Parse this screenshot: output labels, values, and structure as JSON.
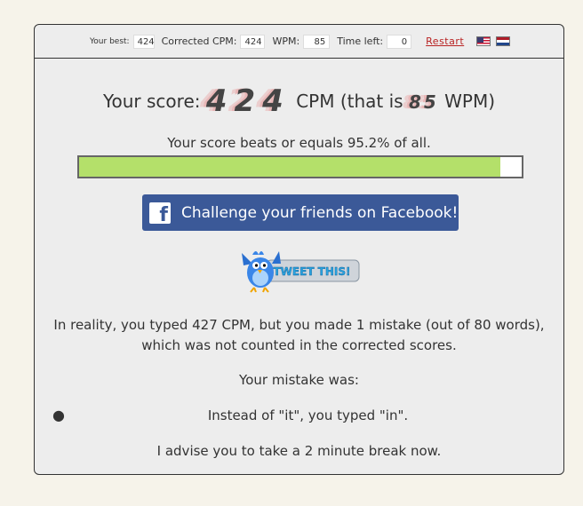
{
  "stats": {
    "best_label": "Your best:",
    "best_value": "424",
    "cpm_label": "Corrected CPM:",
    "cpm_value": "424",
    "wpm_label": "WPM:",
    "wpm_value": "85",
    "time_label": "Time left:",
    "time_value": "0",
    "restart_label": "Restart"
  },
  "languages": [
    "english-flag-icon",
    "dutch-flag-icon"
  ],
  "score": {
    "prefix": "Your score:",
    "cpm": "424",
    "middle": "CPM (that is",
    "wpm": "85",
    "suffix": "WPM)"
  },
  "beats": {
    "text": "Your score beats or equals 95.2% of all.",
    "percent": 95.2,
    "bar_color": "#b4e06a"
  },
  "facebook": {
    "label": "Challenge your friends on Facebook!",
    "logo": "f",
    "color": "#3b5998"
  },
  "tweet": {
    "label": "TWEET THIS!"
  },
  "reality": {
    "line1": "In reality, you typed 427 CPM, but you made 1 mistake (out of 80 words),",
    "line2": "which was not counted in the corrected scores."
  },
  "mistakes": {
    "title": "Your mistake was:",
    "items": [
      "Instead of \"it\", you typed \"in\"."
    ]
  },
  "advice": "I advise you to take a 2 minute break now."
}
